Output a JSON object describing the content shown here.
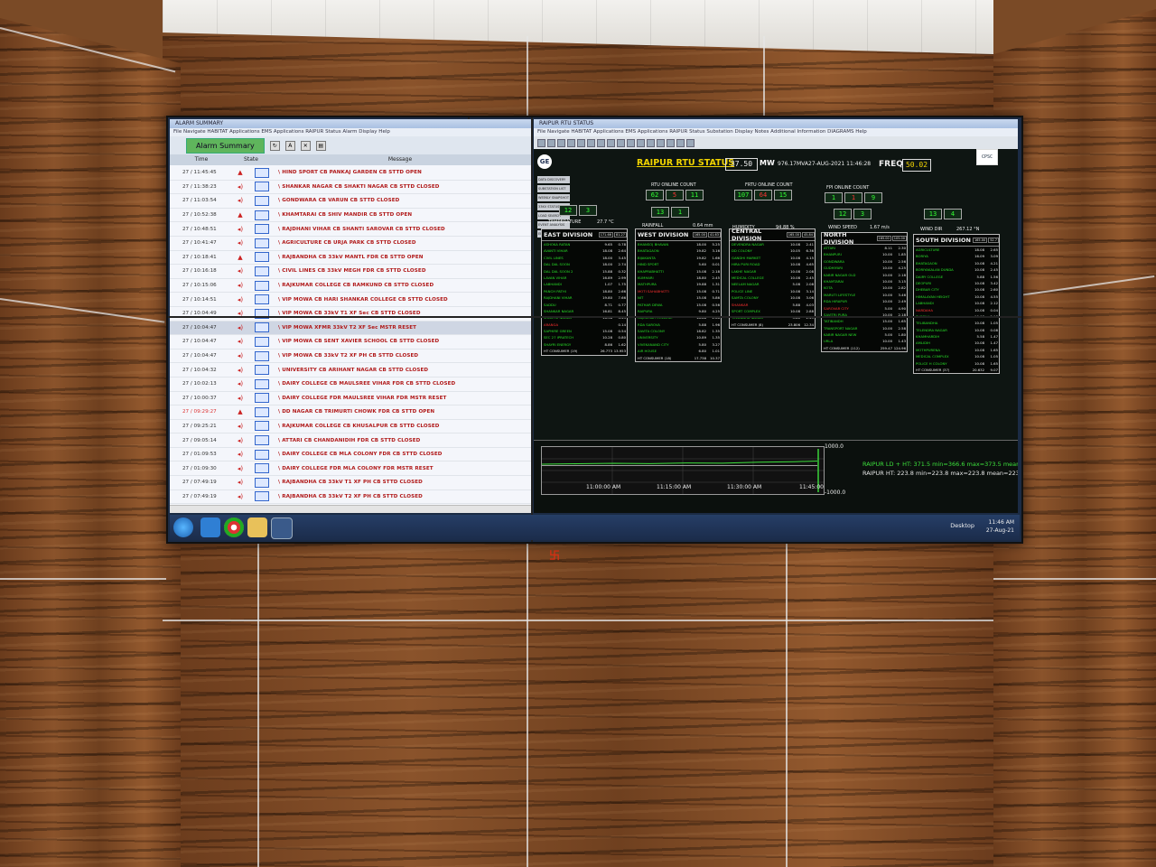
{
  "alarm_window": {
    "title": "Alarm Summary",
    "columns": {
      "time": "Time",
      "state": "State",
      "message": "Message"
    },
    "rows": [
      {
        "time": "27 / 11:45:45",
        "msg": "\\ HIND SPORT    CB    PANKAJ GARDEN CB    STTD OPEN",
        "red": true
      },
      {
        "time": "27 / 11:38:23",
        "msg": "\\ SHANKAR NAGAR    CB    SHAKTI NAGAR CB    STTD CLOSED",
        "red": false
      },
      {
        "time": "27 / 11:03:54",
        "msg": "\\ GONDWARA    CB    VARUN CB    STTD CLOSED",
        "red": false
      },
      {
        "time": "27 / 10:52:38",
        "msg": "\\ KHAMTARAI    CB    SHIV MANDIR CB    STTD OPEN",
        "red": true
      },
      {
        "time": "27 / 10:48:51",
        "msg": "\\ RAJDHANI VIHAR    CB    SHANTI SAROVAR CB    STTD CLOSED",
        "red": false
      },
      {
        "time": "27 / 10:41:47",
        "msg": "\\ AGRICULTURE    CB    URJA PARK CB    STTD CLOSED",
        "red": false
      },
      {
        "time": "27 / 10:18:41",
        "msg": "\\ RAJBANDHA    CB    33kV MANTL FDR CB    STTD OPEN",
        "red": true
      },
      {
        "time": "27 / 10:16:18",
        "msg": "\\ CIVIL LINES    CB    33kV MEGH FDR CB    STTD CLOSED",
        "red": false
      },
      {
        "time": "27 / 10:15:06",
        "msg": "\\ RAJKUMAR COLLEGE CB    RAMKUND CB    STTD CLOSED",
        "red": false
      },
      {
        "time": "27 / 10:14:51",
        "msg": "\\ VIP MOWA    CB    HARI SHANKAR COLLEGE CB    STTD CLOSED",
        "red": false
      },
      {
        "time": "27 / 10:04:49",
        "msg": "\\ VIP MOWA    CB    33kV T1 XF Sec CB    STTD CLOSED",
        "red": false
      },
      {
        "time": "27 / 10:04:47",
        "msg": "\\ VIP MOWA    XFMR    33kV T2 XF Sec    MSTR RESET",
        "red": false,
        "sel": true
      },
      {
        "time": "27 / 10:04:47",
        "msg": "\\ VIP MOWA    CB    SENT XAVIER SCHOOL CB    STTD CLOSED",
        "red": false
      },
      {
        "time": "27 / 10:04:47",
        "msg": "\\ VIP MOWA    CB    33kV T2 XF PH CB    STTD CLOSED",
        "red": false
      },
      {
        "time": "27 / 10:04:32",
        "msg": "\\ UNIVERSITY    CB    ARIHANT NAGAR CB    STTD CLOSED",
        "red": false
      },
      {
        "time": "27 / 10:02:13",
        "msg": "\\ DAIRY COLLEGE CB    MAULSREE VIHAR FDR CB    STTD CLOSED",
        "red": false
      },
      {
        "time": "27 / 10:00:37",
        "msg": "\\ DAIRY COLLEGE    FDR    MAULSREE VIHAR FDR    MSTR RESET",
        "red": false
      },
      {
        "time": "27 / 09:29:27",
        "msg": "\\ DD NAGAR    CB    TRIMURTI CHOWK FDR CB    STTD OPEN",
        "red": true,
        "tred": true
      },
      {
        "time": "27 / 09:25:21",
        "msg": "\\ RAJKUMAR COLLEGE CB    KHUSALPUR CB    STTD CLOSED",
        "red": false
      },
      {
        "time": "27 / 09:05:14",
        "msg": "\\ ATTARI    CB    CHANDANIDIH FDR CB    STTD CLOSED",
        "red": false
      },
      {
        "time": "27 / 01:09:53",
        "msg": "\\ DAIRY COLLEGE    CB    MLA COLONY FDR CB    STTD CLOSED",
        "red": false
      },
      {
        "time": "27 / 01:09:30",
        "msg": "\\ DAIRY COLLEGE    FDR    MLA COLONY FDR    MSTR RESET",
        "red": false
      },
      {
        "time": "27 / 07:49:19",
        "msg": "\\ RAJBANDHA    CB    33kV T1 XF PH CB    STTD CLOSED",
        "red": false
      },
      {
        "time": "27 / 07:49:19",
        "msg": "\\ RAJBANDHA    CB    33kV T2 XF PH CB    STTD CLOSED",
        "red": false
      }
    ]
  },
  "scada": {
    "title": "RAIPUR RTU STATUS",
    "mw": "37.50",
    "mw_unit": "MW",
    "mva": "976.17MVA",
    "datetime": "27-AUG-2021 11:46:28",
    "freq_label": "FREQ",
    "freq": "50.02",
    "nav": [
      "DATA DISCOVERY",
      "SUBSTATION LIST",
      "WEEKLY SNAPSHOT",
      "33KV STATUS",
      "LOAD SEARCH",
      "EVENT ANALYSIS",
      "EMERGENCY"
    ],
    "rtu_count": {
      "label": "RTU ONLINE COUNT",
      "a": "62",
      "b": "5",
      "c": "11"
    },
    "frtu_count": {
      "label": "FRTU ONLINE COUNT",
      "a": "107",
      "b": "64",
      "c": "15"
    },
    "fpi_count": {
      "label": "FPI ONLINE COUNT",
      "a": "1",
      "b": "1",
      "c": "9"
    },
    "small_counts": [
      [
        "12",
        "3"
      ],
      [
        "13",
        "1"
      ],
      [
        "12",
        "3"
      ],
      [
        "13",
        "4"
      ]
    ],
    "weather": [
      {
        "label": "TEMPERATURE",
        "value": "27.7 °C"
      },
      {
        "label": "RAINFALL",
        "value": "0.64 mm"
      },
      {
        "label": "HUMIDITY",
        "value": "94.88 %"
      },
      {
        "label": "WIND SPEED",
        "value": "1.67 m/s"
      },
      {
        "label": "WIND DIR",
        "value": "267.12 °N"
      }
    ],
    "divisions": [
      {
        "name": "EAST DIVISION",
        "mva": "171.66",
        "mw": "81.27",
        "rows": [
          [
            "ASHOKA RATAN",
            "9.65",
            "0.78"
          ],
          [
            "AVANTI VIHAR",
            "18.08",
            "2.64"
          ],
          [
            "CIVIL LINES",
            "18.00",
            "3.45"
          ],
          [
            "DAL DAL SOON",
            "18.00",
            "2.74"
          ],
          [
            "DAL DAL SOON 2",
            "15.88",
            "0.32"
          ],
          [
            "LAVAN VIHAR",
            "16.89",
            "2.99"
          ],
          [
            "LABHANDI",
            "1.07",
            "1.75"
          ],
          [
            "PANCH PATHI",
            "18.80",
            "2.66"
          ],
          [
            "RAJDHANI VIHAR",
            "19.80",
            "7.66"
          ],
          [
            "SADDU",
            "8.71",
            "0.77"
          ],
          [
            "SHANKAR NAGAR",
            "16.81",
            "8.45"
          ],
          [
            "SHASTRI NAGAR",
            "16.38",
            "4.43"
          ],
          [
            "ARANGA",
            "",
            "0.14",
            "red"
          ],
          [
            "SAPHIRE GREEN",
            "15.08",
            "0.54"
          ],
          [
            "SEC 27 IPRATECH",
            "10.28",
            "0.80"
          ],
          [
            "SHAYRI ENERGY",
            "8.86",
            "1.62"
          ],
          [
            "HT CONSUMER (19)",
            "26.773",
            "13.953",
            "white"
          ]
        ]
      },
      {
        "name": "WEST DIVISION",
        "mva": "165.00",
        "mw": "41.63",
        "rows": [
          [
            "BHANSOJ BHAVAN",
            "18.00",
            "5.25"
          ],
          [
            "BHATAGAON",
            "19.82",
            "3.16"
          ],
          [
            "BIJAKANTA",
            "19.82",
            "1.66"
          ],
          [
            "HIND SPORT",
            "5.60",
            "0.01"
          ],
          [
            "KHAPRABHATTI",
            "15.08",
            "2.18"
          ],
          [
            "KUMHARI",
            "18.80",
            "2.45"
          ],
          [
            "MATHPURA",
            "19.88",
            "1.31"
          ],
          [
            "MOTI SAHABHATTI",
            "15.08",
            "0.71",
            "red"
          ],
          [
            "NIT",
            "15.08",
            "5.86"
          ],
          [
            "PATHAR DEWA",
            "15.08",
            "0.56"
          ],
          [
            "RAIPURA",
            "9.80",
            "4.25"
          ],
          [
            "RAJKUMAR COLLEGE",
            "18.88",
            "2.66"
          ],
          [
            "RDA SAROVA",
            "5.88",
            "1.96"
          ],
          [
            "SAVITA COLONY",
            "18.82",
            "1.35"
          ],
          [
            "UNIVERSITY",
            "10.89",
            "1.35"
          ],
          [
            "VIVEKANAND CITY",
            "5.80",
            "3.27"
          ],
          [
            "AIR HOUSE",
            "6.80",
            "1.01"
          ],
          [
            "HT CONSUMER (18)",
            "17.738",
            "10.37",
            "white"
          ]
        ]
      },
      {
        "name": "CENTRAL DIVISION",
        "mva": "165.00",
        "mw": "45.84",
        "rows": [
          [
            "DEVENDRA NAGAR",
            "10.08",
            "2.41"
          ],
          [
            "DD COLONY",
            "10.05",
            "6.36"
          ],
          [
            "GANDHI MARKET",
            "10.08",
            "4.15"
          ],
          [
            "HIRA PURI ROAD",
            "10.08",
            "4.65"
          ],
          [
            "LAKHE NAGAR",
            "10.08",
            "2.08"
          ],
          [
            "MEDICAL COLLEGE",
            "10.08",
            "2.45"
          ],
          [
            "NEELAM NAGAR",
            "5.08",
            "2.08"
          ],
          [
            "POLICE LINE",
            "10.08",
            "3.14"
          ],
          [
            "SAMTA COLONY",
            "10.08",
            "3.06"
          ],
          [
            "SHANKAR",
            "5.88",
            "4.03",
            "red"
          ],
          [
            "SPORT COMPLEX",
            "10.08",
            "2.88"
          ],
          [
            "TELANDRA NAGAR",
            "5.80",
            "2.45"
          ],
          [
            "HT CONSUMER (8)",
            "23.806",
            "12.34",
            "white"
          ]
        ]
      },
      {
        "name": "NORTH DIVISION",
        "mva": "165.00",
        "mw": "105.00",
        "rows": [
          [
            "ATTARI",
            "8.11",
            "2.30"
          ],
          [
            "BHANPURI",
            "10.00",
            "1.85"
          ],
          [
            "GONDWARA",
            "10.00",
            "2.56"
          ],
          [
            "GUDHIYARI",
            "10.00",
            "4.25"
          ],
          [
            "KABIR NAGAR OLD",
            "10.00",
            "2.18"
          ],
          [
            "KHAMTARAI",
            "10.00",
            "3.15"
          ],
          [
            "KOTA",
            "10.00",
            "2.82"
          ],
          [
            "MARUTI LIFESTYLE",
            "10.00",
            "3.46"
          ],
          [
            "RDA HIRAPUR",
            "10.00",
            "2.49"
          ],
          [
            "SAROVAR CITY",
            "5.00",
            "4.90",
            "red"
          ],
          [
            "SAVITRI PURA",
            "10.00",
            "2.18"
          ],
          [
            "TATIBANDH",
            "15.00",
            "1.65"
          ],
          [
            "TRANSPORT NAGAR",
            "10.00",
            "2.58"
          ],
          [
            "KABIR NAGAR NEW",
            "5.00",
            "1.80"
          ],
          [
            "URLA",
            "10.00",
            "1.43"
          ],
          [
            "HT CONSUMER (112)",
            "259.47",
            "124.96",
            "white"
          ]
        ]
      },
      {
        "name": "SOUTH DIVISION",
        "mva": "165.00",
        "mw": "52.7",
        "rows": [
          [
            "AGRICULTURE",
            "18.08",
            "2.65"
          ],
          [
            "BORIYA",
            "16.09",
            "3.09"
          ],
          [
            "BHATAGAON",
            "10.08",
            "4.21"
          ],
          [
            "BORIYAKALAN DUNDA",
            "10.08",
            "2.45"
          ],
          [
            "DAIRY COLLEGE",
            "5.88",
            "1.56"
          ],
          [
            "DEOPURI",
            "10.08",
            "3.42"
          ],
          [
            "DHEBAR CITY",
            "10.08",
            "2.60"
          ],
          [
            "HIMALAYAN HEIGHT",
            "10.08",
            "4.55"
          ],
          [
            "LABHANDI",
            "10.08",
            "2.12"
          ],
          [
            "NARDAHA",
            "10.08",
            "0.04",
            "red"
          ],
          [
            "PURENA",
            "10.08",
            "2.13"
          ],
          [
            "TELIBANDHA",
            "10.08",
            "1.05"
          ],
          [
            "TELENDRA NAGAR",
            "10.08",
            "0.08"
          ],
          [
            "KHAMHARDIH",
            "5.58",
            "1.47"
          ],
          [
            "AMLIDIH",
            "10.08",
            "1.47"
          ],
          [
            "MOTHPURENA",
            "10.08",
            "1.65"
          ],
          [
            "MEDICAL COMPLEX",
            "10.08",
            "1.05"
          ],
          [
            "POLICE H COLONY",
            "10.08",
            "1.65"
          ],
          [
            "HT CONSUMER (37)",
            "20.632",
            "9.07",
            "white"
          ]
        ]
      }
    ],
    "trend": {
      "ymax": "1000.0",
      "ymin": "-1000.0",
      "times": [
        "11:00:00 AM",
        "11:15:00 AM",
        "11:30:00 AM",
        "11:45:00"
      ],
      "legend1": "RAIPUR LD + HT: 371.5 min=366.6 max=373.5 mean=368.8",
      "legend2": "RAIPUR HT: 223.8 min=223.8 max=223.8 mean=223.8"
    }
  },
  "taskbar": {
    "desktop": "Desktop",
    "time": "11:46 AM",
    "date": "27-Aug-21"
  },
  "colors": {
    "alarm_red": "#b01818",
    "scada_green": "#28e028",
    "scada_yellow": "#f2d400",
    "wood": "#7a4a26"
  }
}
